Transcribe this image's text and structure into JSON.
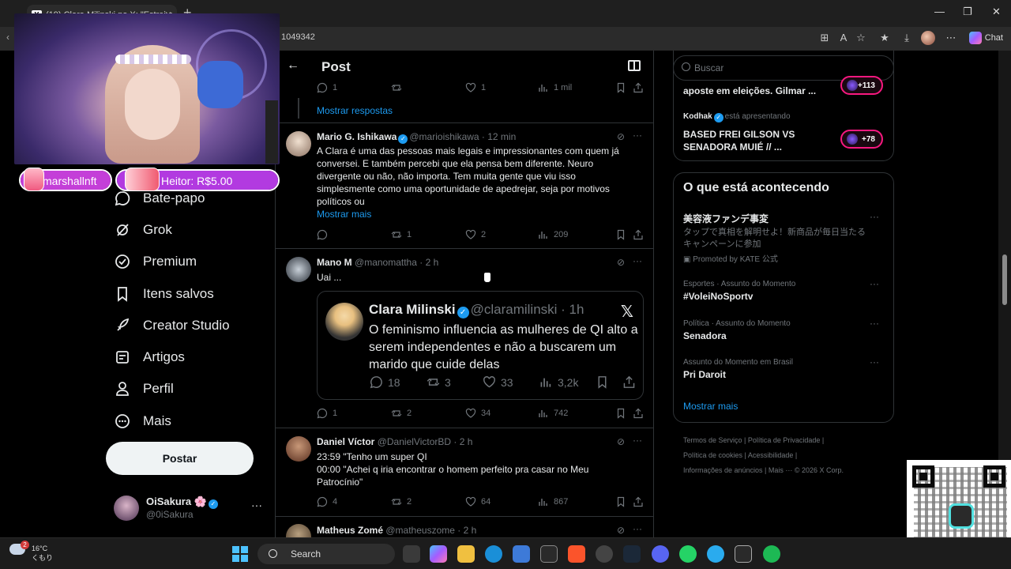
{
  "browser": {
    "tab_title": "(19) Clara Milinski no X: \"Estrei o ...",
    "url_fragment": "1049342",
    "chat_label": "Chat"
  },
  "nav": {
    "items": [
      {
        "label": "Bate-papo",
        "icon": "chat-bubble-icon"
      },
      {
        "label": "Grok",
        "icon": "grok-icon"
      },
      {
        "label": "Premium",
        "icon": "verified-badge-icon"
      },
      {
        "label": "Itens salvos",
        "icon": "bookmark-icon"
      },
      {
        "label": "Creator Studio",
        "icon": "rocket-icon"
      },
      {
        "label": "Artigos",
        "icon": "article-icon"
      },
      {
        "label": "Perfil",
        "icon": "person-icon"
      },
      {
        "label": "Mais",
        "icon": "more-circle-icon"
      }
    ],
    "post_button": "Postar",
    "account": {
      "name": "OiSakura 🌸",
      "handle": "@0iSakura"
    }
  },
  "main": {
    "header_title": "Post",
    "top_actions": {
      "replies": "1",
      "likes": "1",
      "views": "1 mil"
    },
    "show_replies": "Mostrar respostas",
    "tweets": [
      {
        "name": "Mario G. Ishikawa",
        "handle": "@marioishikawa · 12 min",
        "body": "A Clara é uma das pessoas mais legais e impressionantes com quem já\nconversei. E também percebi que ela pensa bem diferente. Neuro\ndivergente ou não, não importa. Tem muita gente que viu isso\nsimplesmente como uma oportunidade de apedrejar, seja por motivos\npolíticos ou",
        "show_more": "Mostrar mais",
        "replies": "",
        "reposts": "1",
        "likes": "2",
        "views": "209"
      },
      {
        "name": "Mano M",
        "handle": "@manomattha · 2 h",
        "body": "Uai ...",
        "replies": "1",
        "reposts": "2",
        "likes": "34",
        "views": "742",
        "quote": {
          "name": "Clara Milinski",
          "handle": "@claramilinski · 1h",
          "body": "O feminismo influencia as mulheres de QI alto a serem independentes e não a buscarem um marido que cuide delas",
          "replies": "18",
          "reposts": "3",
          "likes": "33",
          "views": "3,2k"
        }
      },
      {
        "name": "Daniel Víctor",
        "handle": "@DanielVictorBD · 2 h",
        "body": "23:59 \"Tenho um super QI\n00:00 \"Achei q iria encontrar o homem perfeito pra casar no Meu\nPatrocínio\"",
        "replies": "4",
        "reposts": "2",
        "likes": "64",
        "views": "867"
      },
      {
        "name": "Matheus Zomé",
        "handle": "@matheuszome · 2 h"
      }
    ]
  },
  "sidebar": {
    "search_placeholder": "Buscar",
    "live": [
      {
        "title": "aposte em eleições. Gilmar ...",
        "count": "+113"
      },
      {
        "host": "Kodhak",
        "host_suffix": "está apresentando",
        "title_line1": "BASED FREI GILSON VS",
        "title_line2": "SENADORA MUIÉ // ...",
        "count": "+78"
      }
    ],
    "trends_title": "O que está acontecendo",
    "promo": {
      "title": "美容液ファンデ事変",
      "desc_line1": "タップで真相を解明せよ！新商品が毎日当たる",
      "desc_line2": "キャンペーンに参加",
      "by": "Promoted by KATE 公式"
    },
    "trends": [
      {
        "meta": "Esportes · Assunto do Momento",
        "title": "#VoleiNoSportv"
      },
      {
        "meta": "Política · Assunto do Momento",
        "title": "Senadora"
      },
      {
        "meta": "Assunto do Momento em Brasil",
        "title": "Pri Daroit"
      }
    ],
    "show_more": "Mostrar mais",
    "footer_line1": "Termos de Serviço   |   Política de Privacidade   |",
    "footer_line2": "Política de cookies   |   Acessibilidade   |",
    "footer_line3": "Informações de anúncios   |   Mais ···   © 2026 X Corp."
  },
  "overlay": {
    "donation1": "marshallnft",
    "donation2": "Heitor: R$5.00"
  },
  "taskbar": {
    "temperature": "16°C",
    "condition": "くもり",
    "weather_badge": "2",
    "search_label": "Search"
  },
  "colors": {
    "accent": "#1d9bf0",
    "live": "#f91880",
    "background": "#000000",
    "text": "#e7e9ea",
    "muted": "#71767b"
  }
}
